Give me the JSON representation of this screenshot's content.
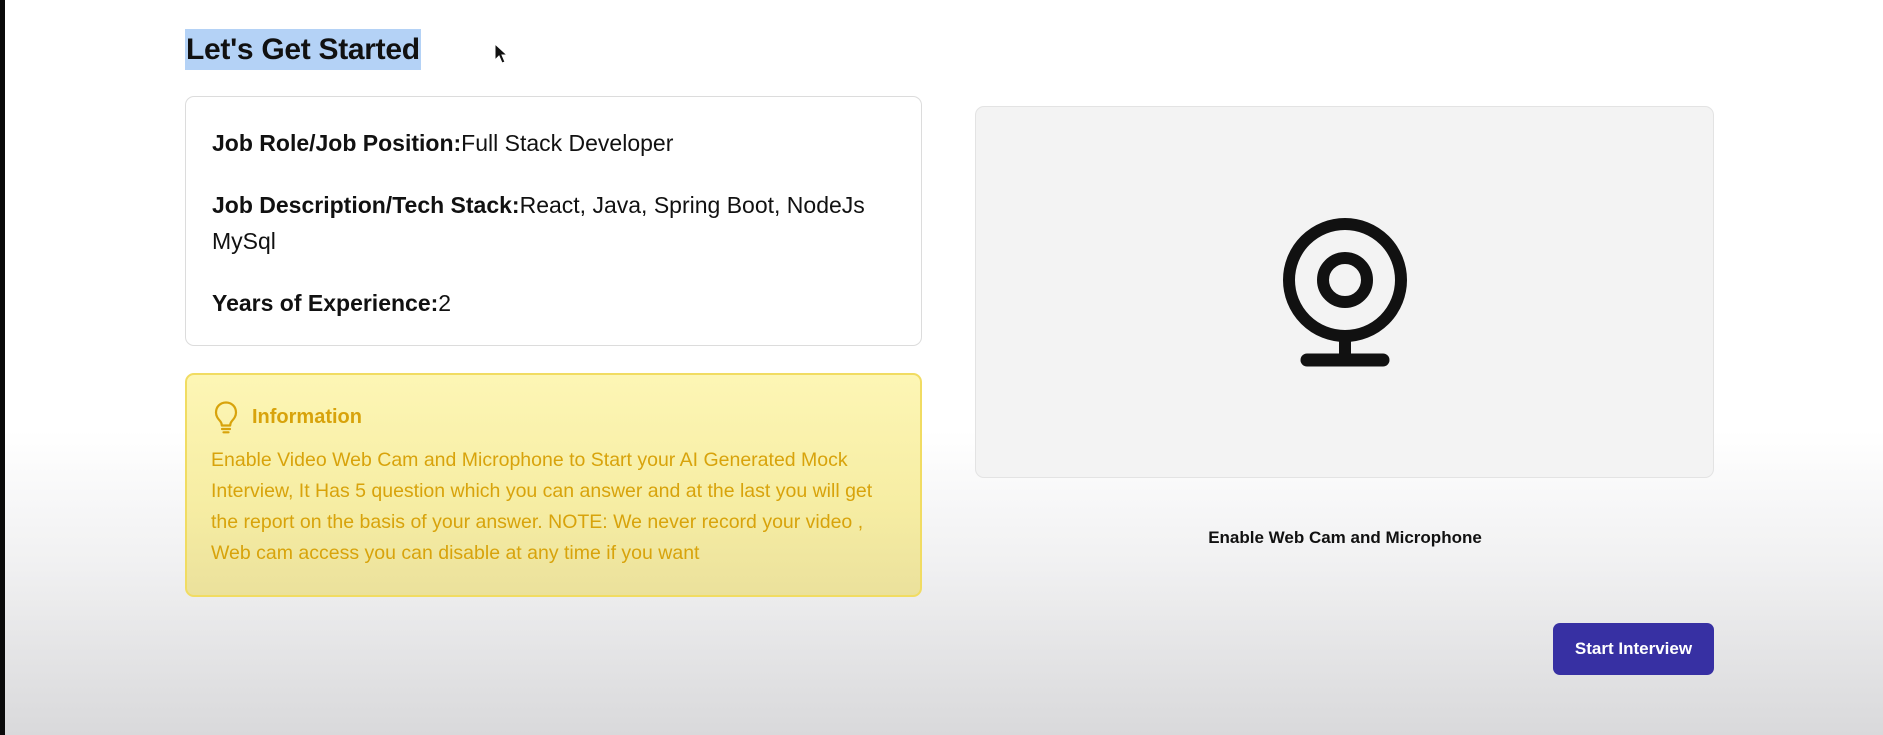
{
  "page": {
    "title": "Let's Get Started"
  },
  "job_details": {
    "role_label": "Job Role/Job Position:",
    "role_value": "Full Stack Developer",
    "description_label": "Job Description/Tech Stack:",
    "description_value": "React, Java, Spring Boot, NodeJs MySql",
    "experience_label": "Years of Experience:",
    "experience_value": "2"
  },
  "information": {
    "icon": "lightbulb-icon",
    "title": "Information",
    "text": "Enable Video Web Cam and Microphone to Start your AI Generated Mock Interview, It Has 5 question which you can answer and at the last you will get the report on the basis of your answer. NOTE: We never record your video , Web cam access you can disable at any time if you want"
  },
  "webcam": {
    "icon": "webcam-icon",
    "enable_label": "Enable Web Cam and Microphone"
  },
  "actions": {
    "start_label": "Start Interview"
  },
  "colors": {
    "accent": "#3730a3",
    "info_text": "#d8a30b",
    "info_bg": "#fdf6b5",
    "selection": "#b4d2f6"
  }
}
